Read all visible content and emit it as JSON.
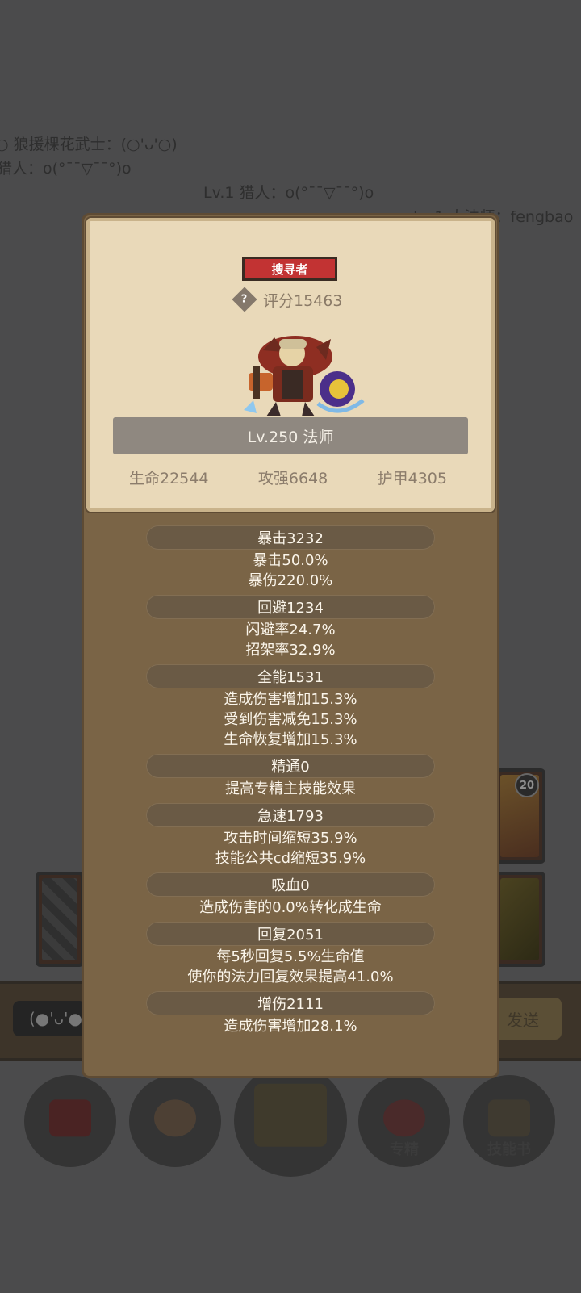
{
  "background": {
    "chat": [
      "○ 狼援棵花武士：(○'ᴗ'○)",
      "猎人：o(°¯¯▽¯¯°)o",
      "Lv.1 猎人：o(°¯¯▽¯¯°)o",
      "Lv.1 大法师：fengbao"
    ],
    "slot_badge": "20",
    "emoji_input": "(●'ᴗ'●",
    "send_label": "发送",
    "nav": [
      {
        "label": "",
        "icon": "backpack-icon"
      },
      {
        "label": "",
        "icon": "bread-icon"
      },
      {
        "label": "",
        "icon": "treasure-chest-icon"
      },
      {
        "label": "专精",
        "icon": "specialization-icon"
      },
      {
        "label": "技能书",
        "icon": "skill-book-icon"
      }
    ]
  },
  "panel": {
    "rank": "搜寻者",
    "score_label": "评分15463",
    "class_label": "Lv.250 法师",
    "main_stats": [
      "生命22544",
      "攻强6648",
      "护甲4305"
    ],
    "stats": [
      {
        "title": "暴击3232",
        "lines": [
          "暴击50.0%",
          "暴伤220.0%"
        ]
      },
      {
        "title": "回避1234",
        "lines": [
          "闪避率24.7%",
          "招架率32.9%"
        ]
      },
      {
        "title": "全能1531",
        "lines": [
          "造成伤害增加15.3%",
          "受到伤害减免15.3%",
          "生命恢复增加15.3%"
        ]
      },
      {
        "title": "精通0",
        "lines": [
          "提高专精主技能效果"
        ]
      },
      {
        "title": "急速1793",
        "lines": [
          "攻击时间缩短35.9%",
          "技能公共cd缩短35.9%"
        ]
      },
      {
        "title": "吸血0",
        "lines": [
          "造成伤害的0.0%转化成生命"
        ]
      },
      {
        "title": "回复2051",
        "lines": [
          "每5秒回复5.5%生命值",
          "使你的法力回复效果提高41.0%"
        ]
      },
      {
        "title": "增伤2111",
        "lines": [
          "造成伤害增加28.1%"
        ]
      }
    ]
  },
  "colors": {
    "overlay": "#4b4b4c",
    "panel_brown": "#7a6446",
    "parchment": "#e9d9b9",
    "rank_red": "#c23333"
  }
}
